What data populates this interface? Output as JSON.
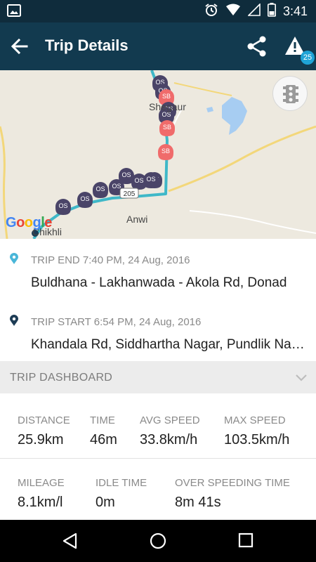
{
  "status_bar": {
    "time": "3:41",
    "icons": [
      "image-icon",
      "alarm-icon",
      "wifi-icon",
      "signal-icon",
      "battery-icon"
    ]
  },
  "app_bar": {
    "title": "Trip Details",
    "alert_badge_count": "25",
    "icons": [
      "back-arrow-icon",
      "share-icon",
      "alert-icon"
    ],
    "color": "#123a4f"
  },
  "map": {
    "labels": {
      "shegaon": "Shegaur",
      "anwi": "Anwi",
      "chikhli": "Chikhli",
      "road_shield": "205"
    },
    "marker_texts": {
      "os": "OS",
      "sb": "SB"
    },
    "google_logo": [
      "G",
      "o",
      "o",
      "g",
      "l",
      "e"
    ],
    "route_color": "#3fb8c8",
    "os_marker_color": "#4a4468",
    "sb_marker_color": "#f06b6b"
  },
  "trip_end": {
    "meta": "TRIP END 7:40 PM, 24 Aug, 2016",
    "address": "Buldhana - Lakhanwada - Akola Rd, Donad",
    "pin_color": "#49b6d8"
  },
  "trip_start": {
    "meta": "TRIP START 6:54 PM, 24 Aug, 2016",
    "address": "Khandala Rd, Siddhartha Nagar, Pundlik Nagar",
    "pin_color": "#1d3c55"
  },
  "dashboard": {
    "header": "TRIP DASHBOARD",
    "row1": [
      {
        "label": "DISTANCE",
        "value": "25.9km"
      },
      {
        "label": "TIME",
        "value": "46m"
      },
      {
        "label": "AVG SPEED",
        "value": "33.8km/h"
      },
      {
        "label": "MAX SPEED",
        "value": "103.5km/h"
      }
    ],
    "row2": [
      {
        "label": "MILEAGE",
        "value": "8.1km/l"
      },
      {
        "label": "IDLE TIME",
        "value": "0m"
      },
      {
        "label": "OVER SPEEDING TIME",
        "value": "8m 41s"
      }
    ]
  },
  "nav_bar": {
    "icons": [
      "nav-back-icon",
      "nav-home-icon",
      "nav-recents-icon"
    ]
  }
}
